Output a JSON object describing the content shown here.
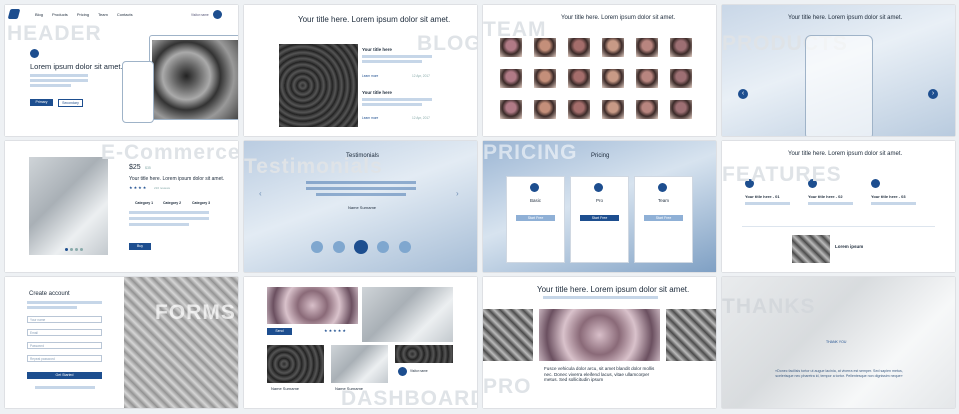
{
  "header": {
    "big": "HEADER",
    "nav": [
      "Blog",
      "Products",
      "Pricing",
      "Team",
      "Contacts"
    ],
    "user": "Visitor name",
    "title": "Lorem ipsum dolor sit amet.",
    "primary": "Primary",
    "secondary": "Secondary"
  },
  "blog": {
    "big": "BLOG",
    "title": "Your title here. Lorem ipsum dolor sit amet.",
    "post1": "Your title here",
    "post2": "Your title here",
    "more": "Learn more",
    "date": "12 Apr, 2017"
  },
  "team": {
    "big": "TEAM",
    "title": "Your title here. Lorem ipsum dolor sit amet."
  },
  "products": {
    "big": "PRODUCTS",
    "title": "Your title here. Lorem ipsum dolor sit amet."
  },
  "ecommerce": {
    "big": "E-Commerce",
    "price": "$25",
    "old_price": "$35",
    "title": "Your title here. Lorem ipsum dolor sit amet.",
    "reviews": "216 reviews",
    "cat1": "Category 1",
    "cat2": "Category 2",
    "cat3": "Category 3",
    "buy": "Buy"
  },
  "testimonials": {
    "big": "Testimonials",
    "title": "Testimonials",
    "name": "Name Surname"
  },
  "pricing": {
    "big": "PRICING",
    "title": "Pricing",
    "plans": [
      {
        "name": "Basic",
        "btn": "Start Free"
      },
      {
        "name": "Pro",
        "btn": "Start Free"
      },
      {
        "name": "Team",
        "btn": "Start Free"
      }
    ]
  },
  "features": {
    "big": "FEATURES",
    "title": "Your title here. Lorem ipsum dolor sit amet.",
    "f1": "Your title here - 01",
    "f2": "Your title here - 02",
    "f3": "Your title here - 03",
    "lorem": "Lorem ipsum"
  },
  "forms": {
    "big": "FORMS",
    "title": "Create account",
    "f1": "Your name",
    "f2": "Email",
    "f3": "Password",
    "f4": "Repeat password",
    "btn": "Get Started"
  },
  "dashboard": {
    "big": "DASHBOARD",
    "name1": "Name Surname",
    "name2": "Name Surname",
    "user": "Visitor name",
    "btn": "Send"
  },
  "pro": {
    "big": "PRO",
    "title": "Your title here. Lorem ipsum dolor sit amet.",
    "text": "Fusce vehicula dolor arcu, sit amet blandit dolor mollis nec. Donec viverra eleifend lacus, vitae ullamcorper metus. Sed sollicitudin ipsum"
  },
  "thanks": {
    "big": "THANKS",
    "label": "THANK YOU",
    "quote": "«Donec facilisis tortor ut augue lacinia, at viverra est semper. Sed sapien metus, scelerisque nec pharetra id, tempor a tortor. Pellentesque non dignissim neque»"
  }
}
